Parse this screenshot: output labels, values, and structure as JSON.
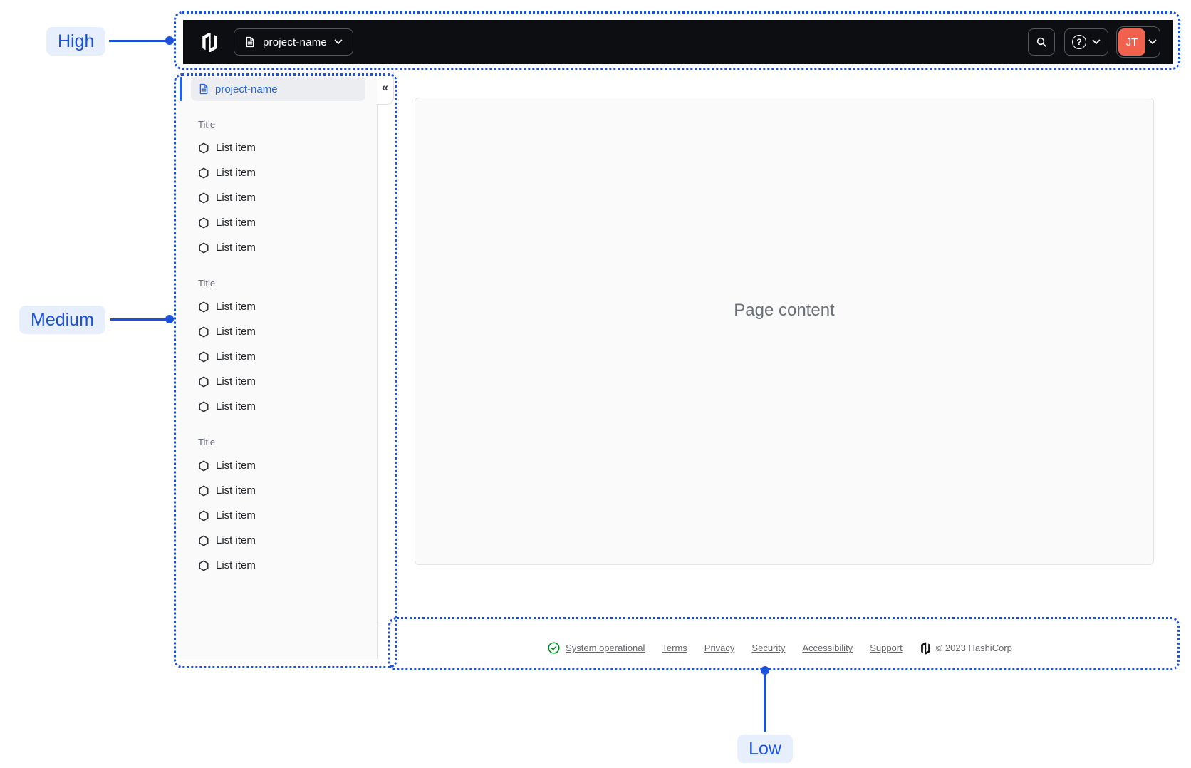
{
  "annotations": {
    "high": "High",
    "medium": "Medium",
    "low": "Low"
  },
  "navbar": {
    "brand_icon": "hashicorp-logo",
    "project_switcher": {
      "label": "project-name",
      "icon": "document-icon",
      "chevron": "chevron-down-icon"
    },
    "search_icon": "magnifier",
    "help_icon": "question-mark-circle",
    "account": {
      "initials": "JT"
    }
  },
  "sidebar": {
    "header": {
      "label": "project-name",
      "icon": "document-icon"
    },
    "collapse_glyph": "«",
    "sections": [
      {
        "title": "Title",
        "items": [
          "List item",
          "List item",
          "List item",
          "List item",
          "List item"
        ]
      },
      {
        "title": "Title",
        "items": [
          "List item",
          "List item",
          "List item",
          "List item",
          "List item"
        ]
      },
      {
        "title": "Title",
        "items": [
          "List item",
          "List item",
          "List item",
          "List item",
          "List item"
        ]
      }
    ]
  },
  "main": {
    "placeholder": "Page content"
  },
  "footer": {
    "status_label": "System operational",
    "status_icon": "check-circle",
    "brand_icon": "hashicorp-logo",
    "links": [
      "Terms",
      "Privacy",
      "Security",
      "Accessibility",
      "Support"
    ],
    "copyright": "© 2023 HashiCorp"
  },
  "colors": {
    "annotation_blue": "#1B51DB",
    "annotation_pill_bg": "#E8EFFC",
    "navbar_bg": "#0D0E12",
    "avatar_orange": "#F0624D",
    "active_blue": "#2563D9",
    "success_green": "#008A22",
    "sidebar_bg": "#FAFAFA"
  }
}
